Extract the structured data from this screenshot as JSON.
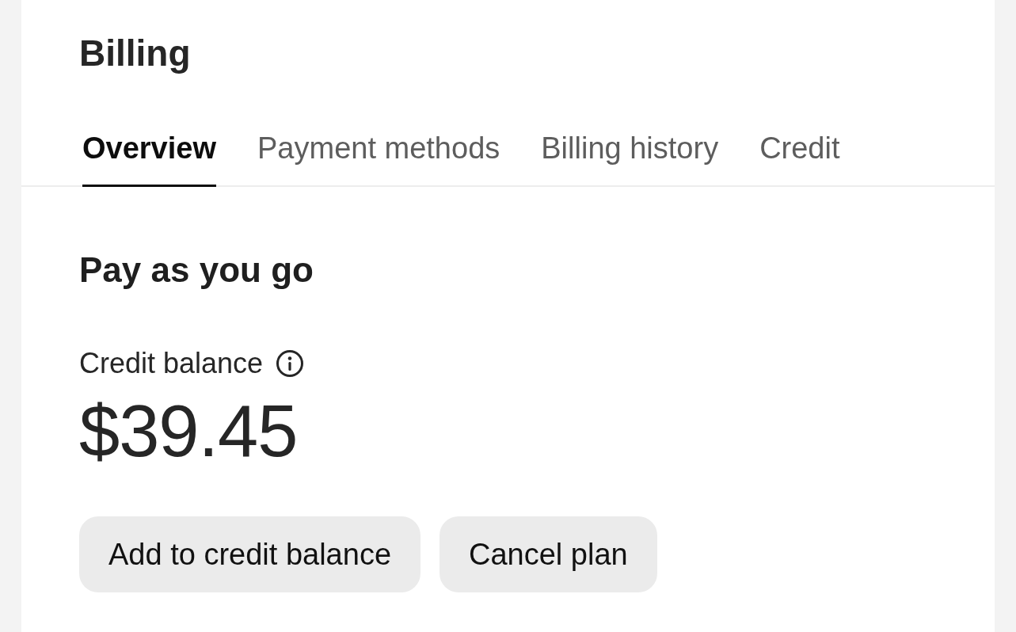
{
  "page": {
    "title": "Billing"
  },
  "tabs": [
    {
      "label": "Overview",
      "selected": true
    },
    {
      "label": "Payment methods",
      "selected": false
    },
    {
      "label": "Billing history",
      "selected": false
    },
    {
      "label": "Credit",
      "selected": false
    }
  ],
  "plan": {
    "title": "Pay as you go",
    "balance_label": "Credit balance",
    "balance": "$39.45"
  },
  "buttons": [
    {
      "label": "Add to credit balance"
    },
    {
      "label": "Cancel plan"
    }
  ]
}
